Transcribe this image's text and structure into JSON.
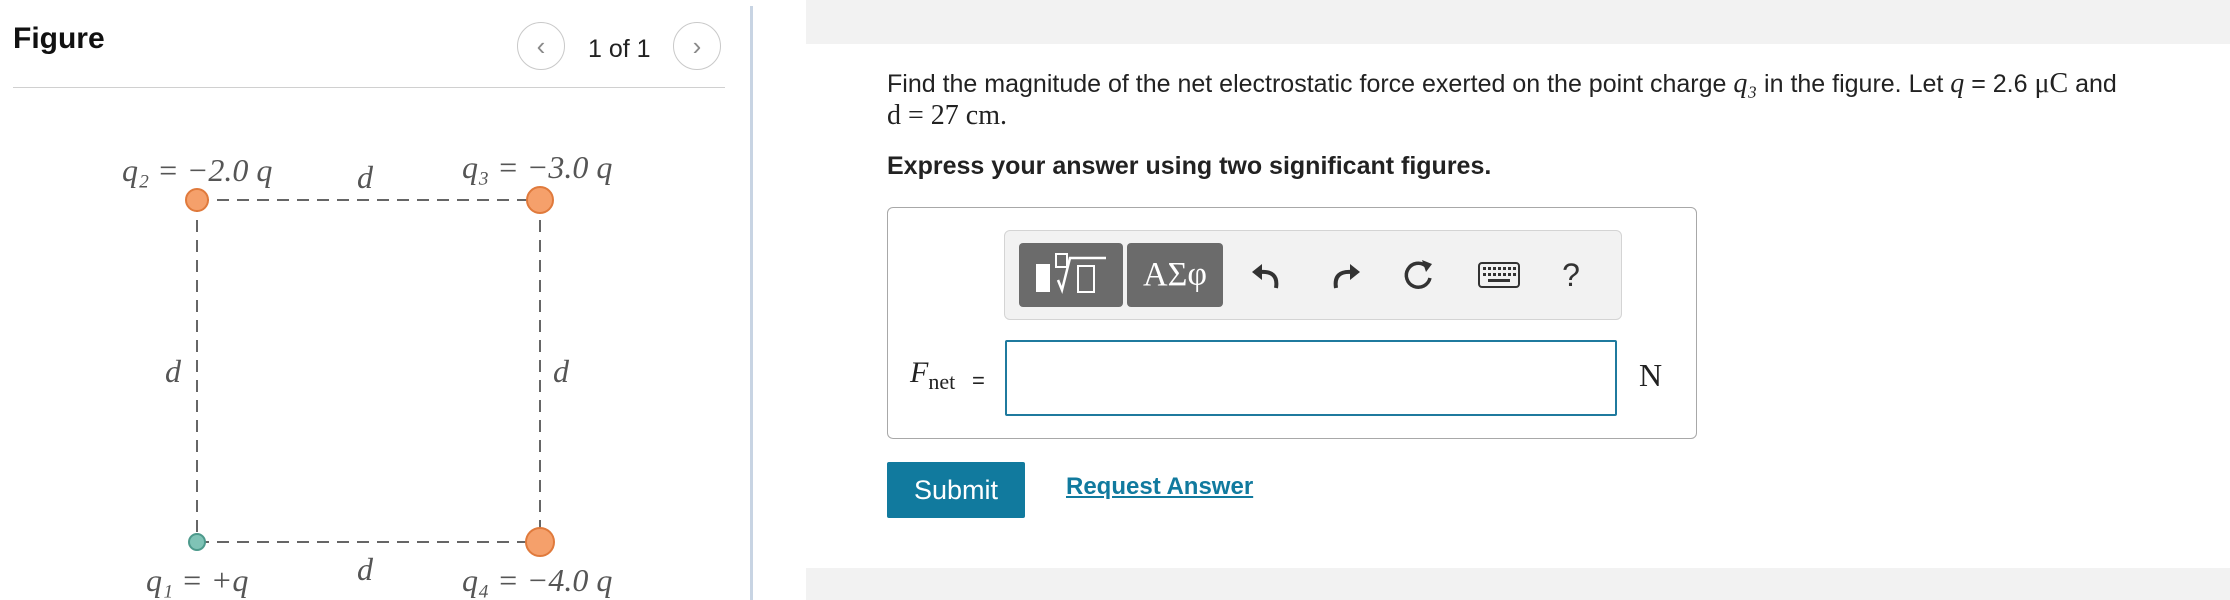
{
  "figure": {
    "title": "Figure",
    "pager": "1 of 1",
    "labels": {
      "q2": "q₂ = −2.0 q",
      "q3": "q₃ = −3.0 q",
      "q1": "q₁ = +q",
      "q4": "q₄ = −4.0 q",
      "d": "d"
    },
    "colors": {
      "negative_charge": "#f5a06b",
      "negative_charge_stroke": "#e07a3c",
      "positive_charge": "#7fc3b6",
      "positive_charge_stroke": "#4d9a8c",
      "dashed_line": "#666666"
    }
  },
  "question": {
    "text_before_q3": "Find the magnitude of the net electrostatic force exerted on the point charge ",
    "q3_symbol": "q₃",
    "text_after_q3": " in the figure. Let ",
    "q_symbol": "q",
    "q_value": " = 2.6 ",
    "q_unit": "μC",
    "and_word": " and",
    "d_expr": "d = 27 cm.",
    "instruction": "Express your answer using two significant figures."
  },
  "toolbar": {
    "templates_icon": "templates-icon",
    "symbols_label": "ΑΣφ",
    "undo_icon": "undo-icon",
    "redo_icon": "redo-icon",
    "reset_icon": "reset-icon",
    "keyboard_icon": "keyboard-icon",
    "help_label": "?"
  },
  "answer": {
    "variable_main": "F",
    "variable_sub": "net",
    "equals": "=",
    "value": "",
    "unit": "N"
  },
  "actions": {
    "submit_label": "Submit",
    "request_label": "Request Answer"
  },
  "colors": {
    "accent": "#117a9e",
    "toolbar_button": "#6b6b6b"
  }
}
